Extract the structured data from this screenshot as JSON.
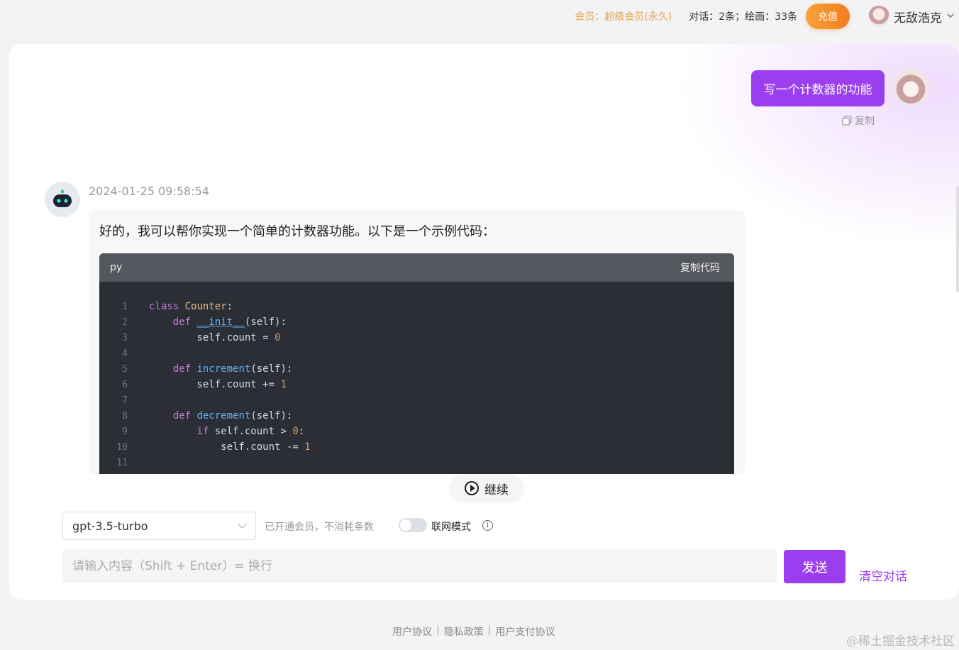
{
  "topbar": {
    "member_status": "会员：超级会员(永久)",
    "usage": "对话：2条；绘画：33条",
    "recharge_label": "充值",
    "username": "无敌浩克",
    "dropdown_icon": "chevron-down-icon"
  },
  "conversation": {
    "user_message": "写一个计数器的功能",
    "copy_label": "复制",
    "bot_timestamp": "2024-01-25 09:58:54",
    "bot_intro": "好的，我可以帮你实现一个简单的计数器功能。以下是一个示例代码：",
    "code": {
      "language": "py",
      "copy_label": "复制代码",
      "line_numbers": [
        "1",
        "2",
        "3",
        "4",
        "5",
        "6",
        "7",
        "8",
        "9",
        "10",
        "11"
      ]
    }
  },
  "continue_label": "继续",
  "controls": {
    "model": "gpt-3.5-turbo",
    "member_note": "已开通会员，不消耗条数",
    "web_mode_label": "联网模式",
    "web_mode_enabled": false,
    "input_placeholder": "请输入内容（Shift + Enter）= 换行",
    "send_label": "发送",
    "clear_label": "清空对话"
  },
  "footer": {
    "links": [
      "用户协议",
      "隐私政策",
      "用户支付协议"
    ]
  },
  "watermark": "@稀土掘金技术社区",
  "colors": {
    "accent": "#9b3ef0",
    "recharge": "#f37d1f",
    "member": "#e8a34a",
    "code_bg": "#2b2e35"
  }
}
